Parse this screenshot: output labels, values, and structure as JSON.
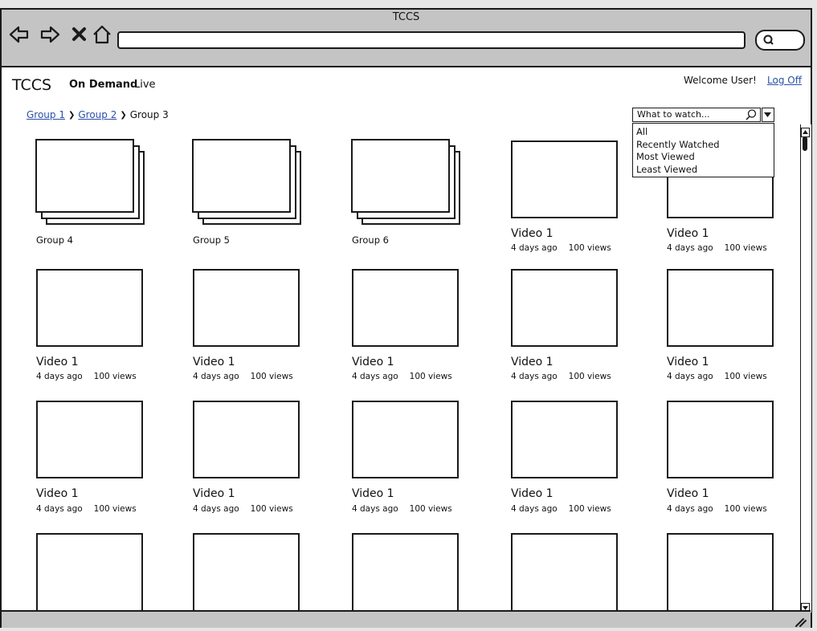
{
  "window": {
    "title": "TCCS"
  },
  "browser": {
    "nav_icons": [
      "back-icon",
      "forward-icon",
      "stop-icon",
      "home-icon"
    ],
    "search_icon": "search-icon"
  },
  "header": {
    "app_title": "TCCS",
    "nav": {
      "on_demand": "On Demand",
      "live": "Live"
    },
    "welcome": "Welcome User!",
    "logoff": "Log Off"
  },
  "breadcrumb": {
    "links": [
      "Group 1",
      "Group 2"
    ],
    "current": "Group 3",
    "separator_icon": "chevron-right-icon"
  },
  "search": {
    "placeholder": "What to watch...",
    "options": [
      "All",
      "Recently Watched",
      "Most Viewed",
      "Least Viewed"
    ]
  },
  "grid": {
    "groups": [
      {
        "label": "Group 4"
      },
      {
        "label": "Group 5"
      },
      {
        "label": "Group 6"
      }
    ],
    "videos": [
      {
        "title": "Video 1",
        "age": "4 days ago",
        "views": "100 views"
      },
      {
        "title": "Video 1",
        "age": "4 days ago",
        "views": "100 views"
      },
      {
        "title": "Video 1",
        "age": "4 days ago",
        "views": "100 views"
      },
      {
        "title": "Video 1",
        "age": "4 days ago",
        "views": "100 views"
      },
      {
        "title": "Video 1",
        "age": "4 days ago",
        "views": "100 views"
      },
      {
        "title": "Video 1",
        "age": "4 days ago",
        "views": "100 views"
      },
      {
        "title": "Video 1",
        "age": "4 days ago",
        "views": "100 views"
      },
      {
        "title": "Video 1",
        "age": "4 days ago",
        "views": "100 views"
      },
      {
        "title": "Video 1",
        "age": "4 days ago",
        "views": "100 views"
      },
      {
        "title": "Video 1",
        "age": "4 days ago",
        "views": "100 views"
      },
      {
        "title": "Video 1",
        "age": "4 days ago",
        "views": "100 views"
      },
      {
        "title": "Video 1",
        "age": "4 days ago",
        "views": "100 views"
      }
    ]
  }
}
